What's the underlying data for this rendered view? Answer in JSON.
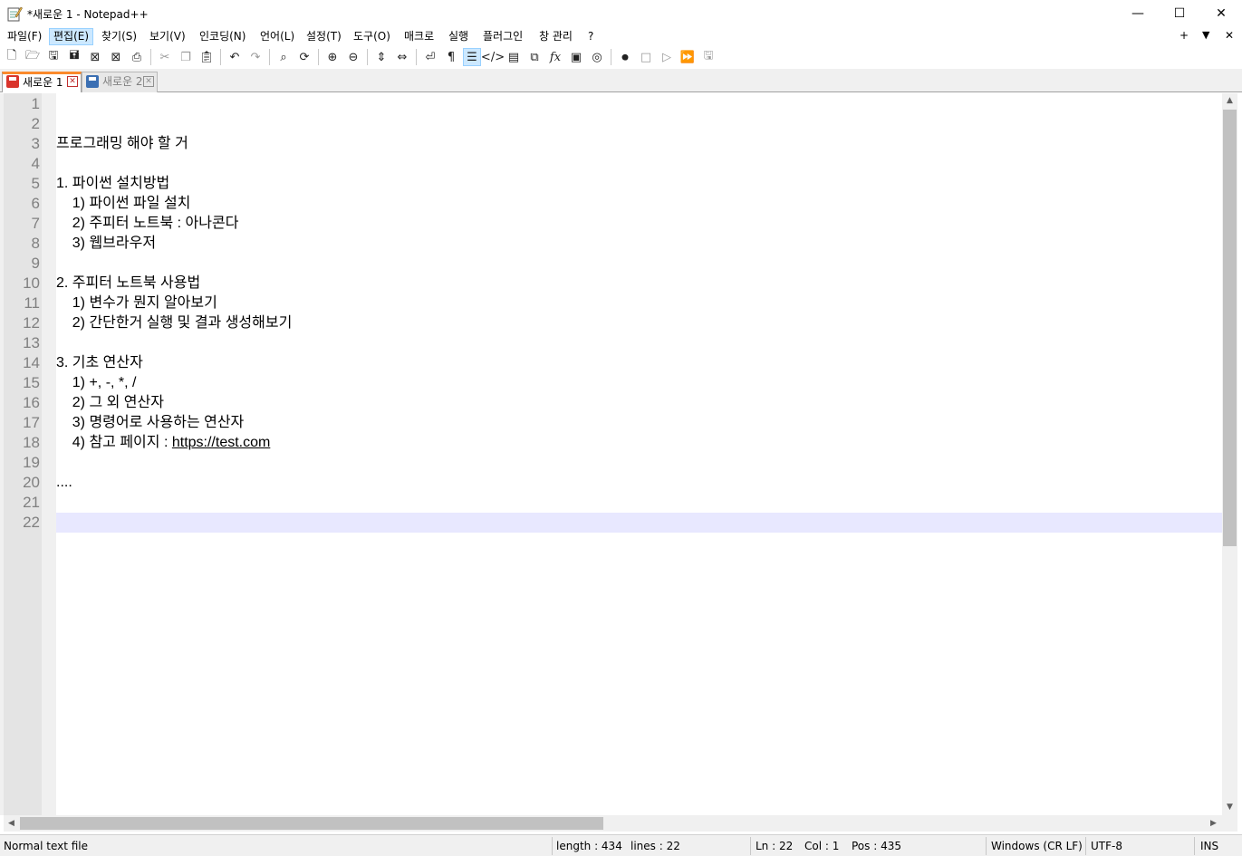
{
  "window": {
    "title": "*새로운 1 - Notepad++",
    "min_glyph": "—",
    "max_glyph": "☐",
    "close_glyph": "✕"
  },
  "menu": {
    "items": [
      "파일(F)",
      "편집(E)",
      "찾기(S)",
      "보기(V)",
      "인코딩(N)",
      "언어(L)",
      "설정(T)",
      "도구(O)",
      "매크로",
      "실행",
      "플러그인",
      "창 관리",
      "?"
    ],
    "right_plus": "+",
    "right_down": "▼",
    "right_close": "✕"
  },
  "toolbar": {
    "icons": [
      "new-file-icon",
      "open-file-icon",
      "save-icon",
      "save-all-icon",
      "close-icon",
      "close-all-icon",
      "print-icon",
      "cut-icon",
      "copy-icon",
      "paste-icon",
      "undo-icon",
      "redo-icon",
      "find-icon",
      "replace-icon",
      "zoom-in-icon",
      "zoom-out-icon",
      "sync-vertical-icon",
      "sync-horizontal-icon",
      "word-wrap-icon",
      "show-all-chars-icon",
      "indent-guide-icon",
      "xml-tag-icon",
      "document-map-icon",
      "clone-doc-icon",
      "function-list-icon",
      "monitoring-icon",
      "document-list-icon",
      "record-macro-icon",
      "stop-record-icon",
      "play-macro-icon",
      "run-macro-multiple-icon",
      "save-macro-icon"
    ]
  },
  "tabs": [
    {
      "label": "새로운 1",
      "active": true
    },
    {
      "label": "새로운 2",
      "active": false
    }
  ],
  "editor": {
    "line_numbers": [
      "1",
      "2",
      "3",
      "4",
      "5",
      "6",
      "7",
      "8",
      "9",
      "10",
      "11",
      "12",
      "13",
      "14",
      "15",
      "16",
      "17",
      "18",
      "19",
      "20",
      "21",
      "22"
    ],
    "lines": [
      "",
      "",
      "프로그래밍 해야 할 거",
      "",
      "1. 파이썬 설치방법",
      "    1) 파이썬 파일 설치",
      "    2) 주피터 노트북 : 아나콘다",
      "    3) 웹브라우저",
      "",
      "2. 주피터 노트북 사용법",
      "    1) 변수가 뭔지 알아보기",
      "    2) 간단한거 실행 및 결과 생성해보기",
      "",
      "3. 기초 연산자",
      "    1) +, -, *, /",
      "    2) 그 외 연산자",
      "    3) 명령어로 사용하는 연산자",
      "    4) 참고 페이지 : ",
      "",
      "....",
      "",
      ""
    ],
    "link_text": "https://test.com",
    "current_line": 22
  },
  "statusbar": {
    "file_type": "Normal text file",
    "length": "length : 434",
    "lines": "lines : 22",
    "ln": "Ln : 22",
    "col": "Col : 1",
    "pos": "Pos : 435",
    "eol": "Windows (CR LF)",
    "encoding": "UTF-8",
    "mode": "INS"
  },
  "colors": {
    "current_line": "#e8e8ff",
    "tab_accent": "#fa8a2c",
    "gutter": "#e4e4e4"
  }
}
